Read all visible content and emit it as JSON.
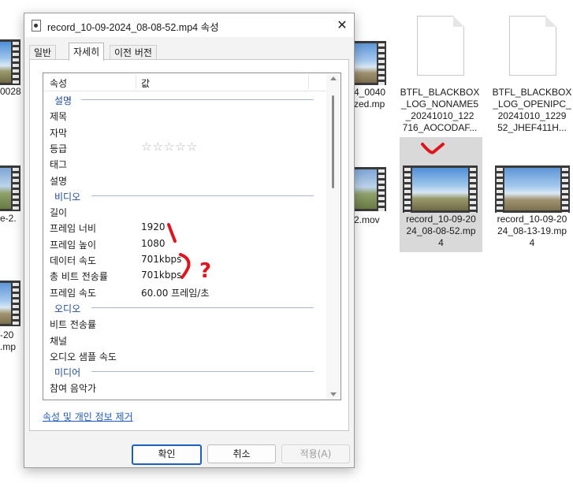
{
  "explorer": {
    "left_files": [
      {
        "name_line1": "0028"
      },
      {
        "name_line1": "e-2."
      },
      {
        "name_line1": "-20",
        "name_line2": ".mp"
      }
    ],
    "partial_files": [
      {
        "line1": "4_0040",
        "line2": "zed.mp"
      },
      {
        "line1": "2.mov"
      }
    ],
    "doc_files": [
      {
        "lines": [
          "BTFL_BLACKBOX",
          "_LOG_NONAME5",
          "_20241010_122",
          "716_AOCODAF..."
        ]
      },
      {
        "lines": [
          "BTFL_BLACKBOX",
          "_LOG_OPENIPC_",
          "20241010_1229",
          "52_JHEF411H..."
        ]
      }
    ],
    "video_files": [
      {
        "lines": [
          "record_10-09-20",
          "24_08-08-52.mp",
          "4"
        ],
        "selected": true
      },
      {
        "lines": [
          "record_10-09-20",
          "24_08-13-19.mp",
          "4"
        ],
        "selected": false
      }
    ]
  },
  "dialog": {
    "title": "record_10-09-2024_08-08-52.mp4 속성",
    "close_glyph": "✕",
    "tabs": [
      "일반",
      "자세히",
      "이전 버전"
    ],
    "active_tab": "자세히",
    "columns": {
      "property": "속성",
      "value": "값"
    },
    "rows": [
      {
        "type": "group",
        "label": "설명"
      },
      {
        "type": "item",
        "key": "제목",
        "value": ""
      },
      {
        "type": "item",
        "key": "자막",
        "value": ""
      },
      {
        "type": "rating",
        "key": "등급",
        "value": "☆☆☆☆☆"
      },
      {
        "type": "item",
        "key": "태그",
        "value": ""
      },
      {
        "type": "item",
        "key": "설명",
        "value": ""
      },
      {
        "type": "group",
        "label": "비디오"
      },
      {
        "type": "item",
        "key": "길이",
        "value": ""
      },
      {
        "type": "item",
        "key": "프레임 너비",
        "value": "1920"
      },
      {
        "type": "item",
        "key": "프레임 높이",
        "value": "1080"
      },
      {
        "type": "item",
        "key": "데이터 속도",
        "value": "701kbps"
      },
      {
        "type": "item",
        "key": "총 비트 전송률",
        "value": "701kbps"
      },
      {
        "type": "item",
        "key": "프레임 속도",
        "value": "60.00 프레임/초"
      },
      {
        "type": "group",
        "label": "오디오"
      },
      {
        "type": "item",
        "key": "비트 전송률",
        "value": ""
      },
      {
        "type": "item",
        "key": "채널",
        "value": ""
      },
      {
        "type": "item",
        "key": "오디오 샘플 속도",
        "value": ""
      },
      {
        "type": "group",
        "label": "미디어"
      },
      {
        "type": "item",
        "key": "참여 음악가",
        "value": ""
      }
    ],
    "remove_link": "속성 및 개인 정보 제거",
    "buttons": {
      "ok": "확인",
      "cancel": "취소",
      "apply": "적용(A)"
    }
  },
  "annotation": {
    "text": "?",
    "color": "#e0141c"
  }
}
